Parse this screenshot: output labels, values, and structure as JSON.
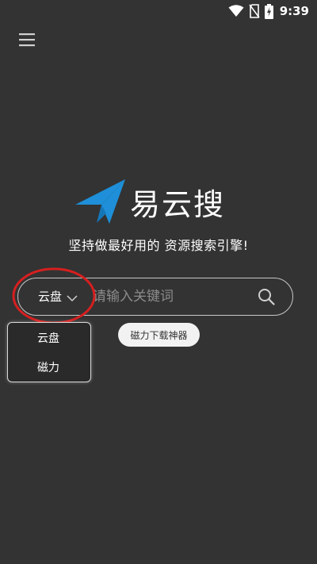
{
  "status_bar": {
    "time": "9:39",
    "icons": [
      "wifi-icon",
      "no-sim-icon",
      "battery-charging-icon"
    ]
  },
  "header": {
    "menu_icon": "hamburger-menu-icon"
  },
  "logo": {
    "icon": "paper-plane-icon",
    "text": "易云搜",
    "brand_color": "#1e8fd8"
  },
  "slogan": "坚持做最好用的 资源搜索引擎!",
  "search": {
    "type_selected": "云盘",
    "placeholder": "请输入关键词",
    "value": "",
    "icon": "search-icon"
  },
  "type_dropdown": {
    "options": [
      "云盘",
      "磁力"
    ]
  },
  "magnet_tool": {
    "label": "磁力下载神器"
  },
  "annotation": {
    "color": "#d61f1f"
  }
}
